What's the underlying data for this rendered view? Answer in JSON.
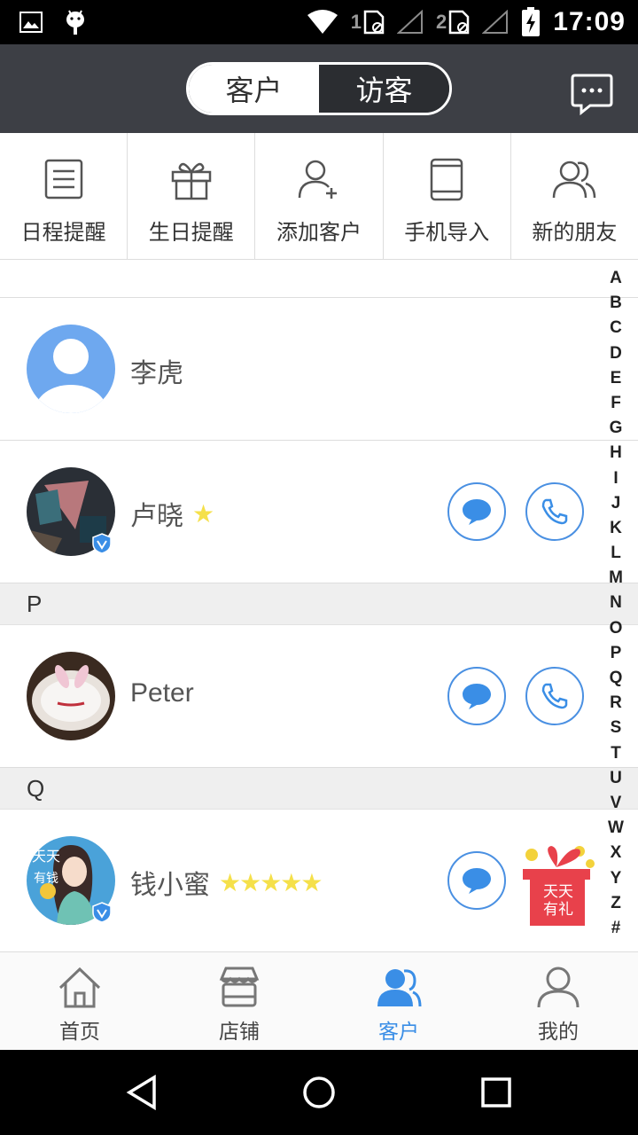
{
  "status_bar": {
    "time": "17:09",
    "sim1": "1",
    "sim2": "2"
  },
  "header": {
    "tabs": [
      {
        "label": "客户",
        "active": true
      },
      {
        "label": "访客",
        "active": false
      }
    ],
    "message_icon": "chat-dots-icon"
  },
  "quick_actions": [
    {
      "label": "日程提醒",
      "icon": "schedule-icon"
    },
    {
      "label": "生日提醒",
      "icon": "gift-icon"
    },
    {
      "label": "添加客户",
      "icon": "add-user-icon"
    },
    {
      "label": "手机导入",
      "icon": "phone-import-icon"
    },
    {
      "label": "新的朋友",
      "icon": "new-friends-icon"
    }
  ],
  "contacts": {
    "lihu": {
      "name": "李虎",
      "stars": ""
    },
    "luxiao": {
      "name": "卢晓",
      "stars": "★"
    },
    "section_p": "P",
    "peter": {
      "name": "Peter",
      "stars": ""
    },
    "section_q": "Q",
    "qianxiaomi": {
      "name": "钱小蜜",
      "stars": "★★★★★"
    }
  },
  "index_letters": [
    "A",
    "B",
    "C",
    "D",
    "E",
    "F",
    "G",
    "H",
    "I",
    "J",
    "K",
    "L",
    "M",
    "N",
    "O",
    "P",
    "Q",
    "R",
    "S",
    "T",
    "U",
    "V",
    "W",
    "X",
    "Y",
    "Z",
    "#"
  ],
  "promo": {
    "line1": "天天",
    "line2": "有礼"
  },
  "avatar_text": {
    "qian_line1": "天天",
    "qian_line2": "有钱"
  },
  "bottom_nav": [
    {
      "label": "首页",
      "icon": "home-icon",
      "active": false
    },
    {
      "label": "店铺",
      "icon": "store-icon",
      "active": false
    },
    {
      "label": "客户",
      "icon": "customers-icon",
      "active": true
    },
    {
      "label": "我的",
      "icon": "profile-icon",
      "active": false
    }
  ],
  "colors": {
    "accent": "#3a8ee6",
    "header_bg": "#3d3f45",
    "star": "#f5e04a",
    "gift_red": "#e8414b"
  }
}
